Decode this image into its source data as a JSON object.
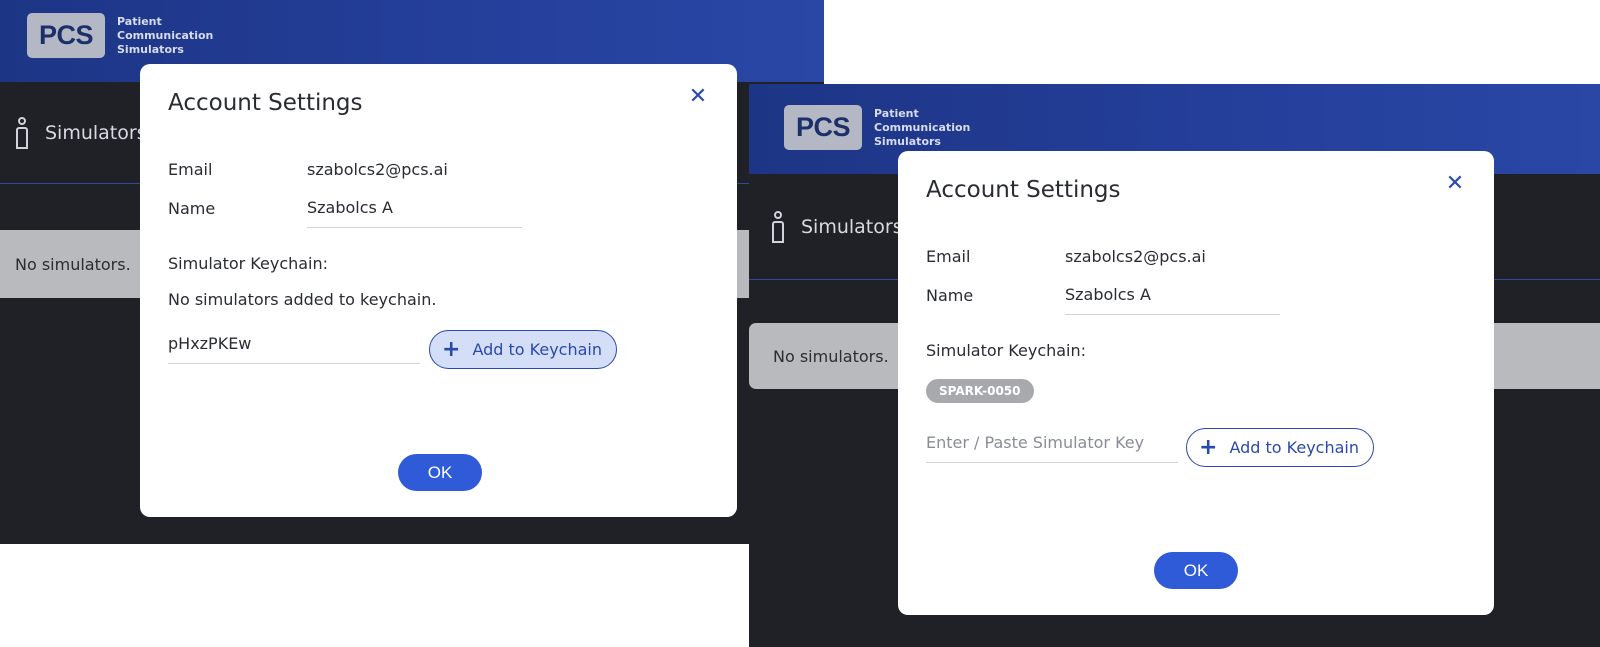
{
  "brand": {
    "logo_mark": "PCS",
    "tagline_lines": [
      "Patient",
      "Communication",
      "Simulators"
    ]
  },
  "nav": {
    "simulators_label": "Simulators",
    "person_icon": "person-icon"
  },
  "empty_state": "No simulators.",
  "dialog_a": {
    "title": "Account Settings",
    "close_glyph": "✕",
    "email_label": "Email",
    "email_value": "szabolcs2@pcs.ai",
    "name_label": "Name",
    "name_value": "Szabolcs A",
    "keychain_label": "Simulator Keychain:",
    "keychain_empty": "No simulators added to keychain.",
    "key_input_value": "pHxzPKEw",
    "key_input_placeholder": "Enter / Paste Simulator Key",
    "add_label": "Add to Keychain",
    "ok_label": "OK"
  },
  "dialog_b": {
    "title": "Account Settings",
    "close_glyph": "✕",
    "email_label": "Email",
    "email_value": "szabolcs2@pcs.ai",
    "name_label": "Name",
    "name_value": "Szabolcs A",
    "keychain_label": "Simulator Keychain:",
    "keychain_items": [
      "SPARK-0050"
    ],
    "key_input_value": "",
    "key_input_placeholder": "Enter / Paste Simulator Key",
    "add_label": "Add to Keychain",
    "ok_label": "OK"
  },
  "colors": {
    "header_blue": "#243f9a",
    "accent_blue": "#2a49b0",
    "ok_blue": "#2f5ad8",
    "dark_bg": "#1f2126"
  }
}
